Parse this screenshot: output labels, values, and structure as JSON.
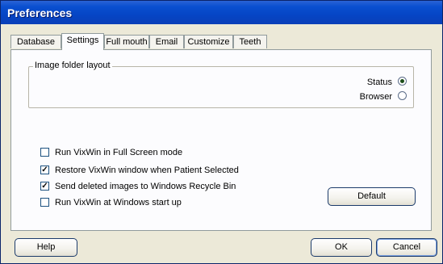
{
  "window": {
    "title": "Preferences"
  },
  "tabs": [
    {
      "label": "Database"
    },
    {
      "label": "Settings"
    },
    {
      "label": "Full mouth"
    },
    {
      "label": "Email"
    },
    {
      "label": "Customize"
    },
    {
      "label": "Teeth"
    }
  ],
  "active_tab": "Settings",
  "image_folder_layout": {
    "legend": "Image folder layout",
    "options": [
      {
        "label": "Status",
        "selected": true
      },
      {
        "label": "Browser",
        "selected": false
      }
    ]
  },
  "checkboxes": [
    {
      "label": "Run VixWin in Full Screen mode",
      "checked": false
    },
    {
      "label": "Restore VixWin window when Patient Selected",
      "checked": true
    },
    {
      "label": "Send deleted images to Windows Recycle Bin",
      "checked": true
    },
    {
      "label": "Run VixWin at Windows start up",
      "checked": false
    }
  ],
  "buttons": {
    "default": "Default",
    "help": "Help",
    "ok": "OK",
    "cancel": "Cancel"
  },
  "colors": {
    "titlebar": "#0a4fd0",
    "dialog_bg": "#ece9d8",
    "panel_bg": "#fcfcfe"
  }
}
